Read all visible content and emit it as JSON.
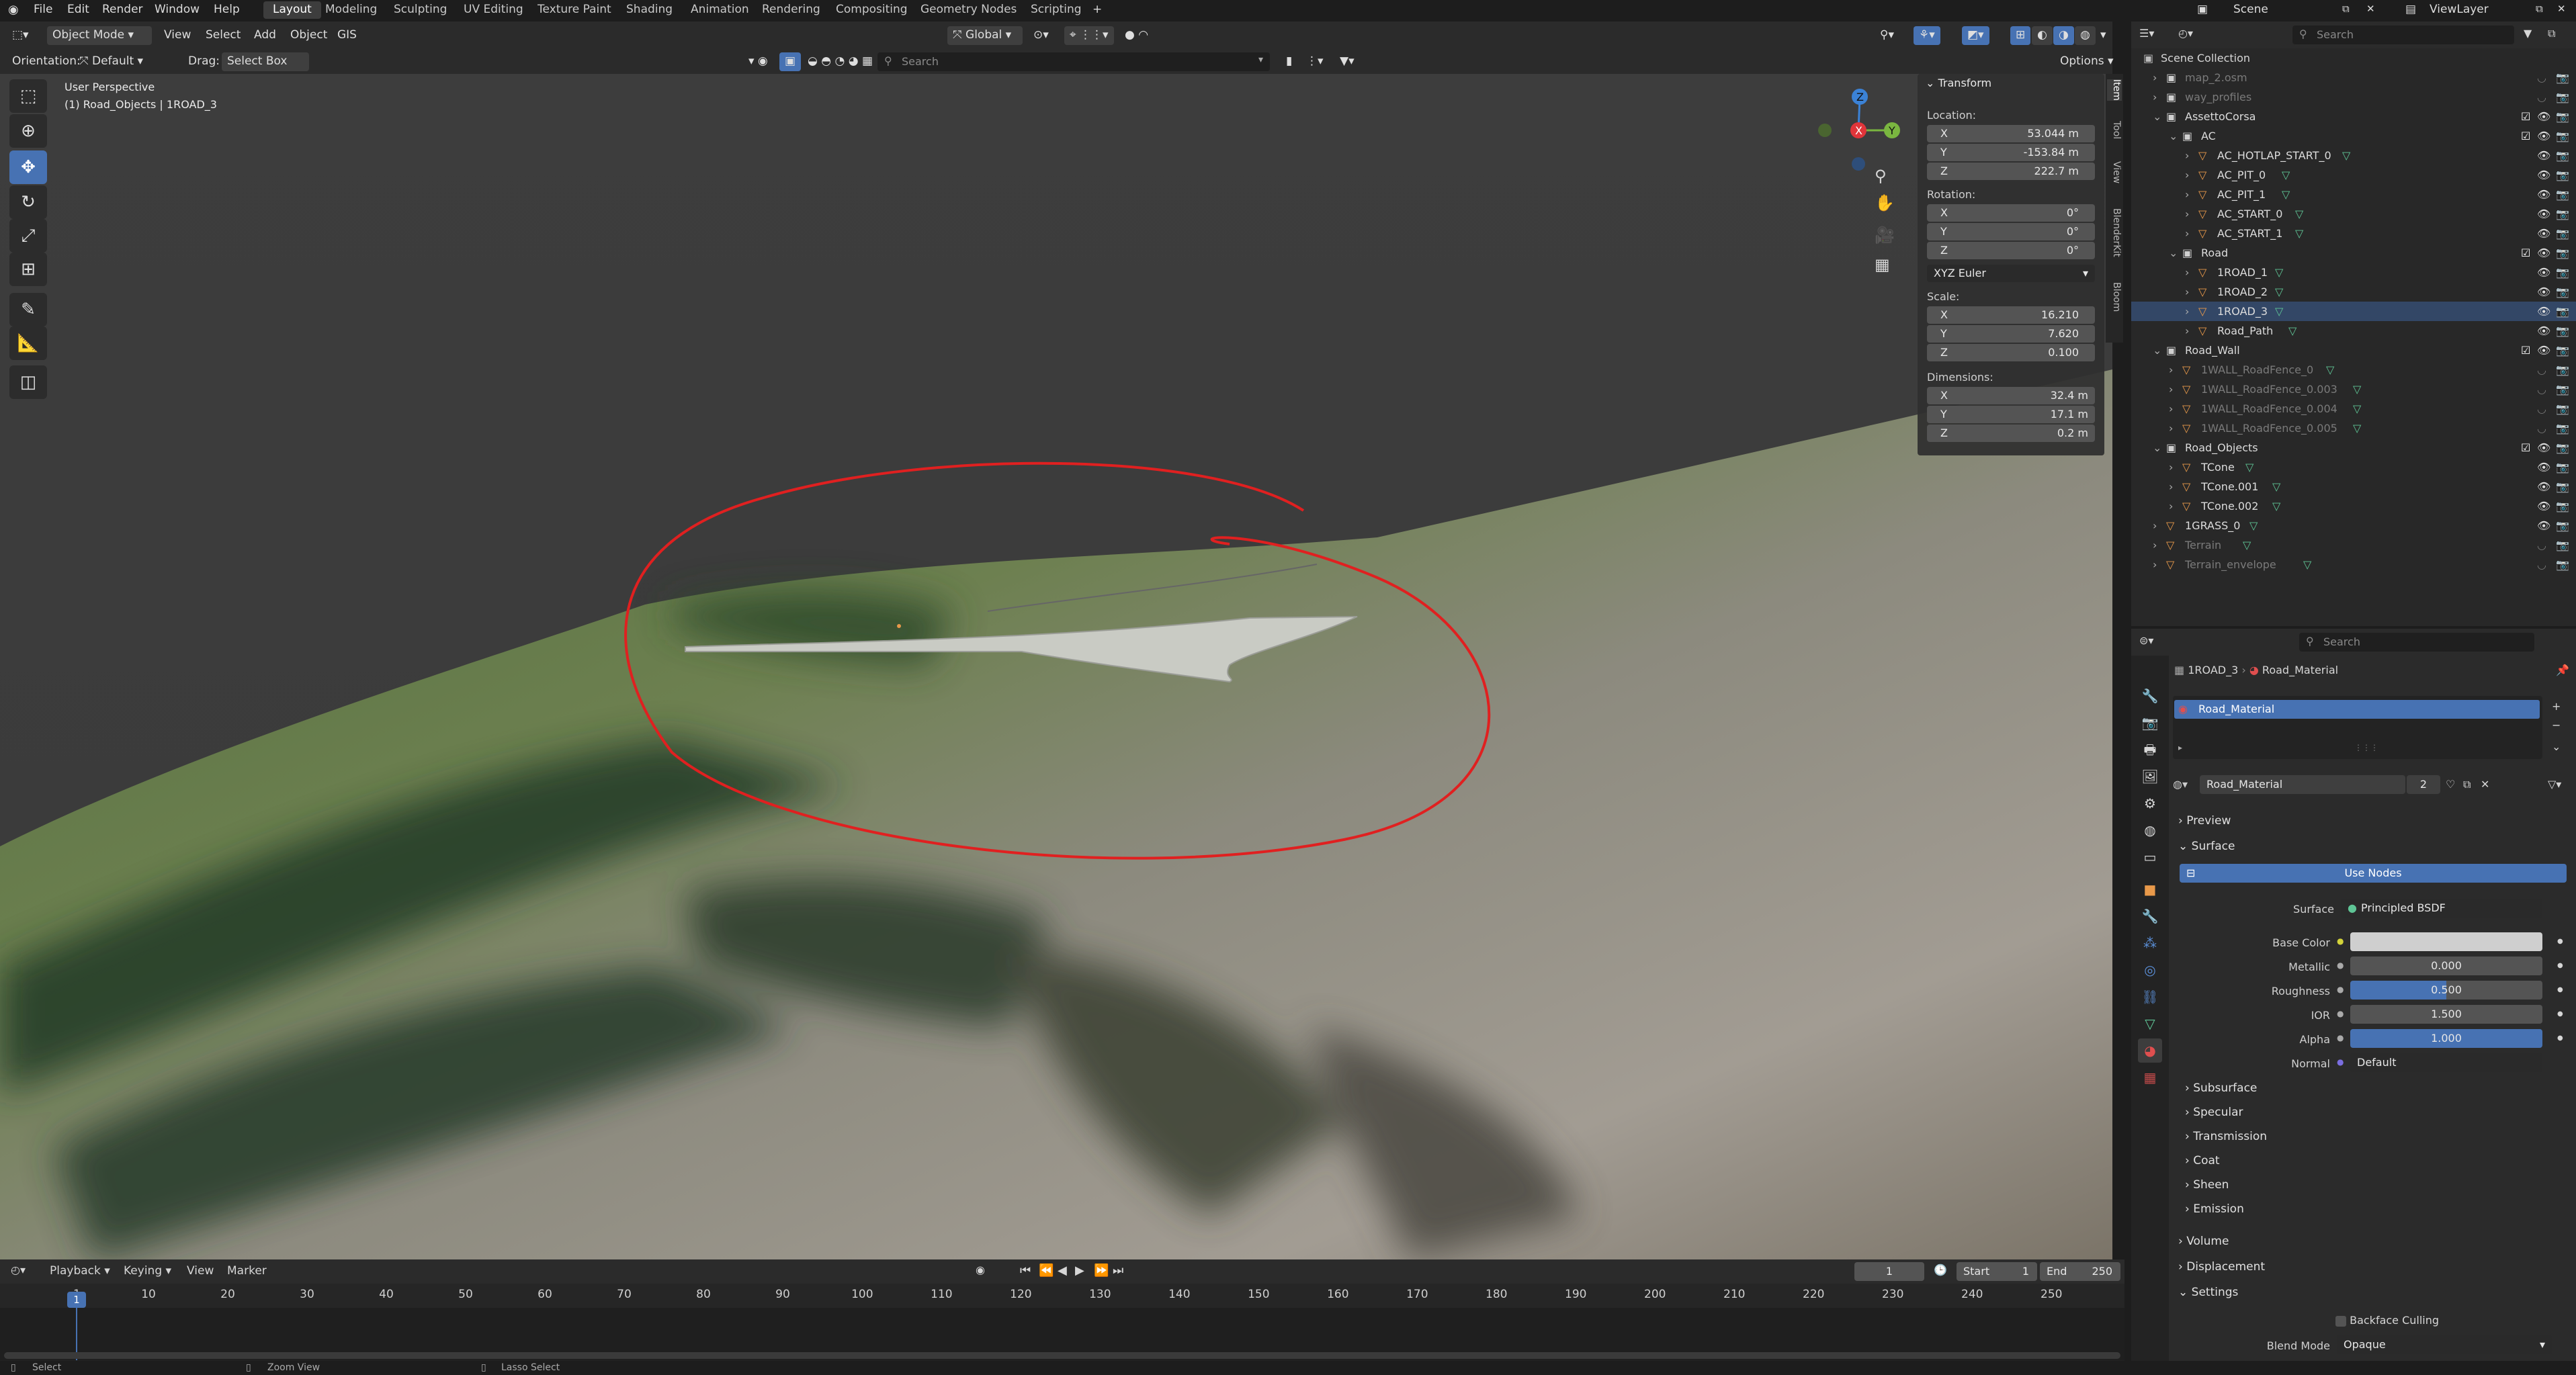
{
  "menubar": {
    "items": [
      "File",
      "Edit",
      "Render",
      "Window",
      "Help"
    ],
    "workspaces": [
      "Layout",
      "Modeling",
      "Sculpting",
      "UV Editing",
      "Texture Paint",
      "Shading",
      "Animation",
      "Rendering",
      "Compositing",
      "Geometry Nodes",
      "Scripting"
    ],
    "scene": "Scene",
    "view_layer": "ViewLayer"
  },
  "viewport_header": {
    "mode": "Object Mode",
    "menus": [
      "View",
      "Select",
      "Add",
      "Object",
      "GIS"
    ],
    "orientation_label": "Orientation:",
    "orientation": "Default",
    "drag_label": "Drag:",
    "drag": "Select Box",
    "transform_orientation": "Global",
    "search_placeholder": "Search",
    "options": "Options"
  },
  "viewport": {
    "perspective": "User Perspective",
    "object_info": "(1) Road_Objects | 1ROAD_3"
  },
  "transform_panel": {
    "title": "Transform",
    "location_label": "Location:",
    "location": {
      "x": "53.044 m",
      "y": "-153.84 m",
      "z": "222.7 m"
    },
    "rotation_label": "Rotation:",
    "rotation": {
      "x": "0°",
      "y": "0°",
      "z": "0°"
    },
    "rotation_mode": "XYZ Euler",
    "scale_label": "Scale:",
    "scale": {
      "x": "16.210",
      "y": "7.620",
      "z": "0.100"
    },
    "dimensions_label": "Dimensions:",
    "dimensions": {
      "x": "32.4 m",
      "y": "17.1 m",
      "z": "0.2 m"
    },
    "axis_labels": {
      "x": "X",
      "y": "Y",
      "z": "Z"
    }
  },
  "sidebar_tabs": [
    "Item",
    "Tool",
    "View",
    "BlenderKit",
    "Bloom"
  ],
  "outliner": {
    "search_placeholder": "Search",
    "root": "Scene Collection",
    "rows": [
      {
        "name": "map_2.osm",
        "depth": 1,
        "dim": true
      },
      {
        "name": "way_profiles",
        "depth": 1,
        "dim": true
      },
      {
        "name": "AssettoCorsa",
        "depth": 1,
        "dim": false
      },
      {
        "name": "AC",
        "depth": 2,
        "dim": false
      },
      {
        "name": "AC_HOTLAP_START_0",
        "depth": 3,
        "dim": false
      },
      {
        "name": "AC_PIT_0",
        "depth": 3,
        "dim": false
      },
      {
        "name": "AC_PIT_1",
        "depth": 3,
        "dim": false
      },
      {
        "name": "AC_START_0",
        "depth": 3,
        "dim": false
      },
      {
        "name": "AC_START_1",
        "depth": 3,
        "dim": false
      },
      {
        "name": "Road",
        "depth": 2,
        "dim": false
      },
      {
        "name": "1ROAD_1",
        "depth": 3,
        "dim": false
      },
      {
        "name": "1ROAD_2",
        "depth": 3,
        "dim": false
      },
      {
        "name": "1ROAD_3",
        "depth": 3,
        "dim": false
      },
      {
        "name": "Road_Path",
        "depth": 3,
        "dim": false
      },
      {
        "name": "Road_Wall",
        "depth": 1,
        "dim": false
      },
      {
        "name": "1WALL_RoadFence_0",
        "depth": 2,
        "dim": true
      },
      {
        "name": "1WALL_RoadFence_0.003",
        "depth": 2,
        "dim": true
      },
      {
        "name": "1WALL_RoadFence_0.004",
        "depth": 2,
        "dim": true
      },
      {
        "name": "1WALL_RoadFence_0.005",
        "depth": 2,
        "dim": true
      },
      {
        "name": "Road_Objects",
        "depth": 1,
        "dim": false
      },
      {
        "name": "TCone",
        "depth": 2,
        "dim": false
      },
      {
        "name": "TCone.001",
        "depth": 2,
        "dim": false
      },
      {
        "name": "TCone.002",
        "depth": 2,
        "dim": false
      },
      {
        "name": "1GRASS_0",
        "depth": 1,
        "dim": false
      },
      {
        "name": "Terrain",
        "depth": 1,
        "dim": true
      },
      {
        "name": "Terrain_envelope",
        "depth": 1,
        "dim": true
      }
    ]
  },
  "properties": {
    "search_placeholder": "Search",
    "breadcrumb_object": "1ROAD_3",
    "breadcrumb_material": "Road_Material",
    "slot": "Road_Material",
    "material_name": "Road_Material",
    "user_count": "2",
    "preview": "Preview",
    "surface": "Surface",
    "use_nodes": "Use Nodes",
    "surface_label": "Surface",
    "surface_value": "Principled BSDF",
    "base_color_label": "Base Color",
    "base_color": "#cfcfcf",
    "metallic_label": "Metallic",
    "metallic": "0.000",
    "roughness_label": "Roughness",
    "roughness": "0.500",
    "ior_label": "IOR",
    "ior": "1.500",
    "alpha_label": "Alpha",
    "alpha": "1.000",
    "normal_label": "Normal",
    "normal": "Default",
    "subsections": [
      "Subsurface",
      "Specular",
      "Transmission",
      "Coat",
      "Sheen",
      "Emission"
    ],
    "volume": "Volume",
    "displacement": "Displacement",
    "settings": "Settings",
    "backface_culling": "Backface Culling",
    "blend_mode_label": "Blend Mode",
    "blend_mode": "Opaque"
  },
  "timeline": {
    "menus": [
      "Playback",
      "Keying",
      "View",
      "Marker"
    ],
    "current_frame": "1",
    "start_label": "Start",
    "start": "1",
    "end_label": "End",
    "end": "250",
    "ticks": [
      "1",
      "10",
      "20",
      "30",
      "40",
      "50",
      "60",
      "70",
      "80",
      "90",
      "100",
      "110",
      "120",
      "130",
      "140",
      "150",
      "160",
      "170",
      "180",
      "190",
      "200",
      "210",
      "220",
      "230",
      "240",
      "250"
    ]
  },
  "status_bar": {
    "items": [
      "Select",
      "Zoom View",
      "Lasso Select"
    ]
  },
  "colors": {
    "accent": "#4772b3",
    "annotation": "#e02020",
    "object_orange": "#e8994a",
    "data_green": "#5fc596"
  }
}
